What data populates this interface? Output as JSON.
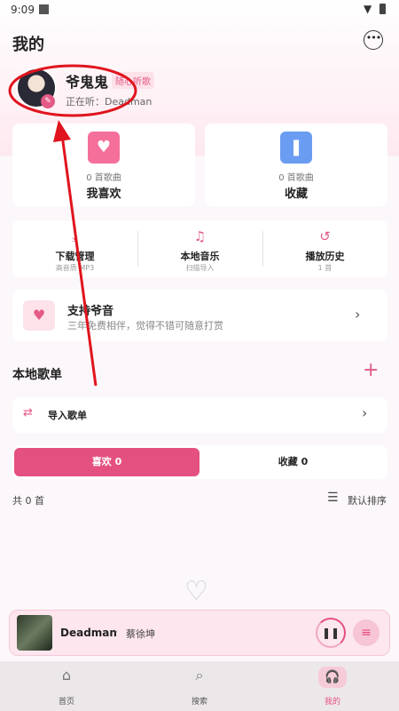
{
  "status_bar": {
    "time": "9:09"
  },
  "header": {
    "title": "我的",
    "more_icon": "more-horizontal-icon"
  },
  "profile": {
    "name": "爷鬼鬼",
    "tag": "随心听歌",
    "now_playing": "正在听：Deadman",
    "edit_icon": "pencil-icon"
  },
  "stats": [
    {
      "count": "0 首歌曲",
      "label": "我喜欢",
      "icon": "heart-icon",
      "color": "#f4709a"
    },
    {
      "count": "0 首歌曲",
      "label": "收藏",
      "icon": "bookmark-icon",
      "color": "#6a9cf2"
    }
  ],
  "tools": [
    {
      "label": "下载管理",
      "sub": "高音质 MP3",
      "icon": "download-icon"
    },
    {
      "label": "本地音乐",
      "sub": "扫描导入",
      "icon": "music-library-icon"
    },
    {
      "label": "播放历史",
      "sub": "1 首",
      "icon": "history-icon"
    }
  ],
  "support": {
    "title": "支持爷音",
    "subtitle": "三年免费相伴，觉得不错可随意打赏",
    "icon": "hand-heart-icon"
  },
  "local_playlists": {
    "title": "本地歌单",
    "add_icon": "plus-icon"
  },
  "import": {
    "label": "导入歌单",
    "icon": "import-link-icon"
  },
  "segments": {
    "likes": "喜欢 0",
    "collections": "收藏 0"
  },
  "list_meta": {
    "total": "共 0 首",
    "sort": "默认排序",
    "sort_icon": "sort-icon"
  },
  "player": {
    "title": "Deadman",
    "separator": "·",
    "artist": "蔡徐坤",
    "play_icon": "pause-icon",
    "queue_icon": "playlist-icon"
  },
  "nav": [
    {
      "label": "首页",
      "icon": "home-icon"
    },
    {
      "label": "搜索",
      "icon": "search-icon"
    },
    {
      "label": "我的",
      "icon": "headphones-icon"
    }
  ],
  "accent_color": "#e4507f",
  "annotation_color": "#e0141e"
}
